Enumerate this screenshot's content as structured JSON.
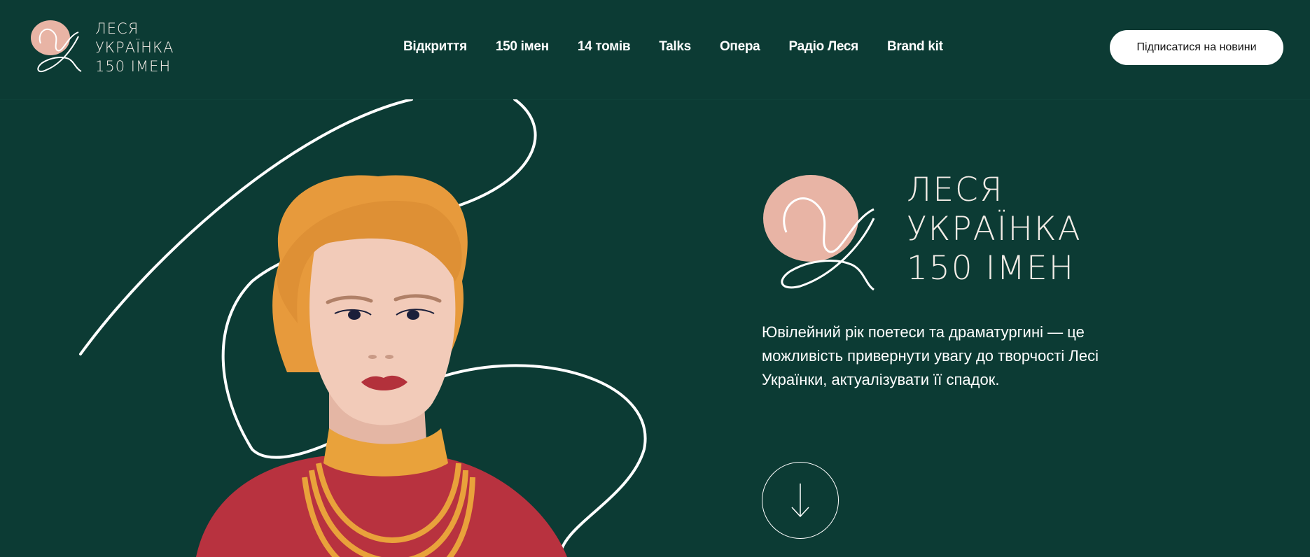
{
  "header": {
    "logo": {
      "line1": "ЛЕСЯ",
      "line2": "УКРАЇНКА",
      "line3": "150 ІМЕН",
      "icon": "lu-monogram-icon"
    },
    "nav": [
      {
        "label": "Відкриття"
      },
      {
        "label": "150 імен"
      },
      {
        "label": "14 томів"
      },
      {
        "label": "Talks"
      },
      {
        "label": "Опера"
      },
      {
        "label": "Радіо Леся"
      },
      {
        "label": "Brand kit"
      }
    ],
    "subscribe_label": "Підписатися на новини"
  },
  "hero": {
    "title": {
      "line1": "ЛЕСЯ",
      "line2": "УКРАЇНКА",
      "line3": "150 ІМЕН"
    },
    "intro": "Ювілейний рік поетеси та драматургині — це можливість привернути увагу до творчості Лесі Українки, актуалізувати її спадок.",
    "scroll_icon": "arrow-down-icon"
  },
  "colors": {
    "background": "#0c3b34",
    "accent_pink": "#e8b4a5",
    "hair": "#e79a3c",
    "dress": "#b8323f",
    "necklace": "#e9a23b"
  }
}
